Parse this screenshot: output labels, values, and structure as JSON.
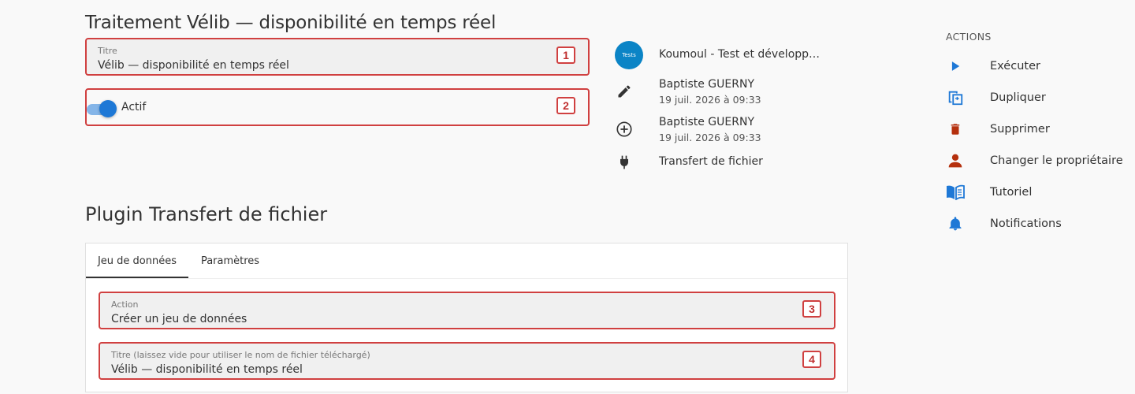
{
  "page": {
    "title": "Traitement Vélib — disponibilité en temps réel"
  },
  "form": {
    "title_label": "Titre",
    "title_value": "Vélib — disponibilité en temps réel",
    "title_marker": "1",
    "active_label": "Actif",
    "active_value": true,
    "active_marker": "2"
  },
  "meta": {
    "organization_avatar_text": "Tests",
    "organization": "Koumoul - Test et développ…",
    "updated_by": "Baptiste GUERNY",
    "updated_at": "19 juil. 2026 à 09:33",
    "created_by": "Baptiste GUERNY",
    "created_at": "19 juil. 2026 à 09:33",
    "plugin": "Transfert de fichier",
    "icons": [
      "organization-avatar",
      "pencil-icon",
      "plus-circle-icon",
      "plug-icon"
    ]
  },
  "plugin": {
    "section_title": "Plugin Transfert de fichier",
    "tabs": [
      {
        "label": "Jeu de données",
        "active": true
      },
      {
        "label": "Paramètres",
        "active": false
      }
    ],
    "action_label": "Action",
    "action_value": "Créer un jeu de données",
    "action_marker": "3",
    "dataset_title_label": "Titre (laissez vide pour utiliser le nom de fichier téléchargé)",
    "dataset_title_value": "Vélib — disponibilité en temps réel",
    "dataset_title_marker": "4"
  },
  "actions": {
    "header": "ACTIONS",
    "items": [
      {
        "label": "Exécuter",
        "icon": "play-icon",
        "color": "#1e78d6"
      },
      {
        "label": "Dupliquer",
        "icon": "duplicate-icon",
        "color": "#1e78d6"
      },
      {
        "label": "Supprimer",
        "icon": "trash-icon",
        "color": "#b5300d"
      },
      {
        "label": "Changer le propriétaire",
        "icon": "person-icon",
        "color": "#b5300d"
      },
      {
        "label": "Tutoriel",
        "icon": "book-icon",
        "color": "#1e78d6"
      },
      {
        "label": "Notifications",
        "icon": "bell-icon",
        "color": "#1e78d6"
      }
    ]
  },
  "colors": {
    "accent": "#1e78d6",
    "danger": "#b5300d",
    "marker": "#d04040"
  }
}
